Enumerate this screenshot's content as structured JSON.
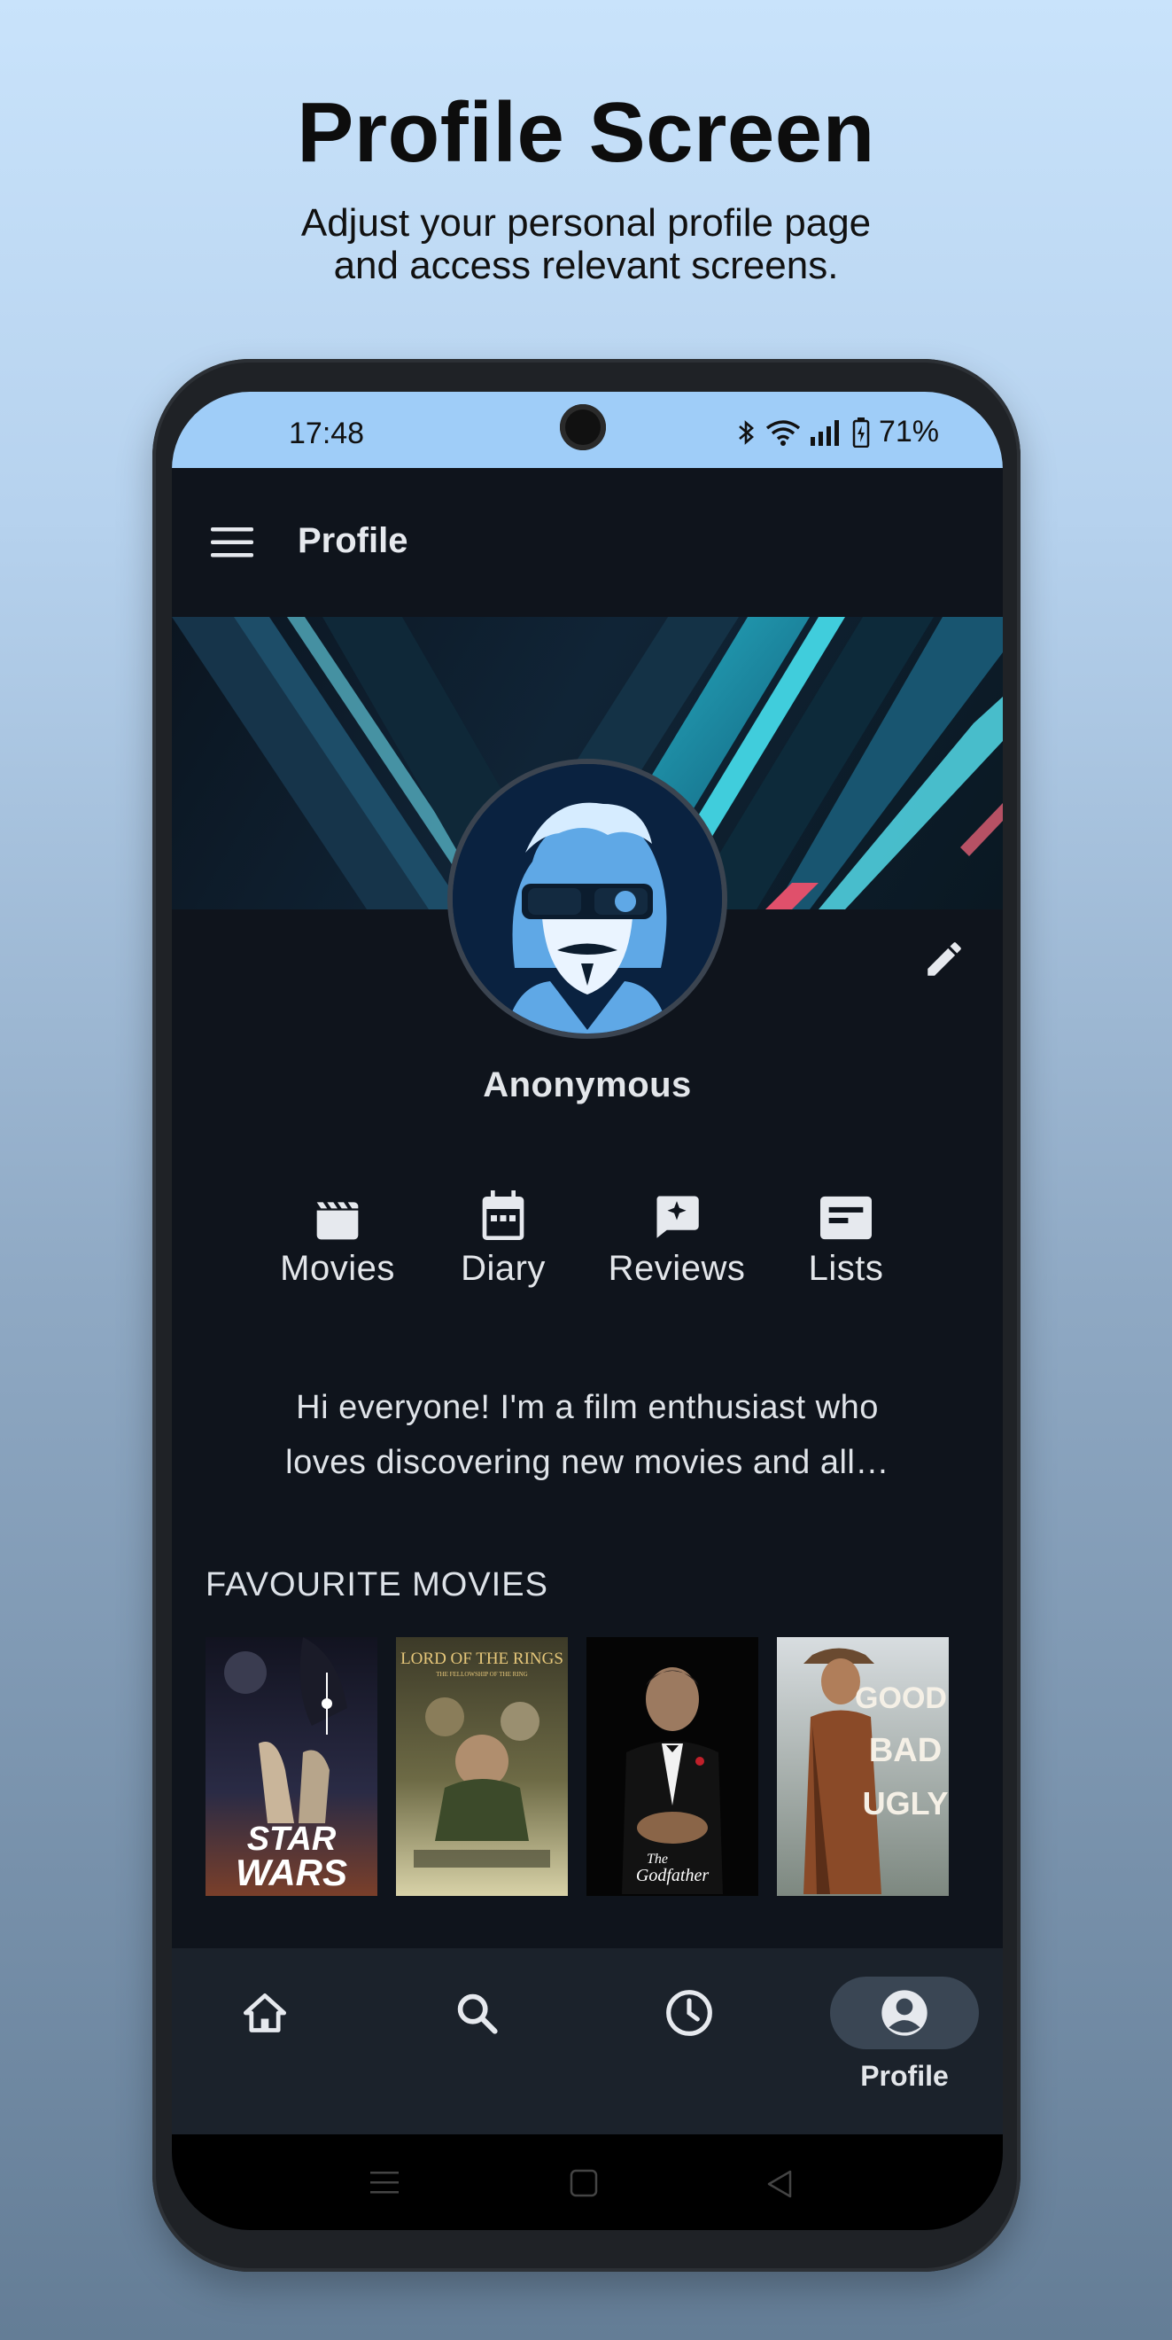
{
  "promo": {
    "title": "Profile Screen",
    "subtitle_line1": "Adjust your personal profile page",
    "subtitle_line2": "and access relevant screens."
  },
  "status_bar": {
    "time": "17:48",
    "battery": "71%",
    "icons": [
      "bluetooth-icon",
      "wifi-icon",
      "signal-icon",
      "battery-icon"
    ]
  },
  "app_bar": {
    "title": "Profile",
    "menu_icon": "menu-icon"
  },
  "profile": {
    "username": "Anonymous",
    "edit_icon": "pencil-icon"
  },
  "sections": [
    {
      "label": "Movies",
      "icon": "clapperboard-icon"
    },
    {
      "label": "Diary",
      "icon": "calendar-icon"
    },
    {
      "label": "Reviews",
      "icon": "review-icon"
    },
    {
      "label": "Lists",
      "icon": "list-icon"
    }
  ],
  "bio": {
    "line1": "Hi everyone! I'm a film enthusiast who",
    "line2": "loves discovering new movies and all…"
  },
  "favourites": {
    "title": "FAVOURITE MOVIES",
    "movies": [
      {
        "title": "Star Wars",
        "poster_text_top": "STAR",
        "poster_text_bottom": "WARS"
      },
      {
        "title": "The Lord of the Rings: The Fellowship of the Ring",
        "poster_text_top": "LORD OF THE RINGS",
        "poster_text_bottom": "THE FELLOWSHIP OF THE RING"
      },
      {
        "title": "The Godfather",
        "poster_text_top": "The",
        "poster_text_bottom": "Godfather"
      },
      {
        "title": "The Good, the Bad and the Ugly",
        "poster_text_top": "GOOD",
        "poster_text_bottom": "UGLY",
        "poster_text_mid": "BAD"
      }
    ]
  },
  "bottom_nav": {
    "items": [
      {
        "icon": "home-icon",
        "label": "",
        "active": false
      },
      {
        "icon": "search-icon",
        "label": "",
        "active": false
      },
      {
        "icon": "clock-icon",
        "label": "",
        "active": false
      },
      {
        "icon": "account-icon",
        "label": "Profile",
        "active": true
      }
    ]
  },
  "colors": {
    "status_bar": "#9fcdf8",
    "background": "#0f141c",
    "bottom_nav": "#1b222b",
    "active_pill": "#3a4654",
    "text": "#e3e6ea"
  }
}
